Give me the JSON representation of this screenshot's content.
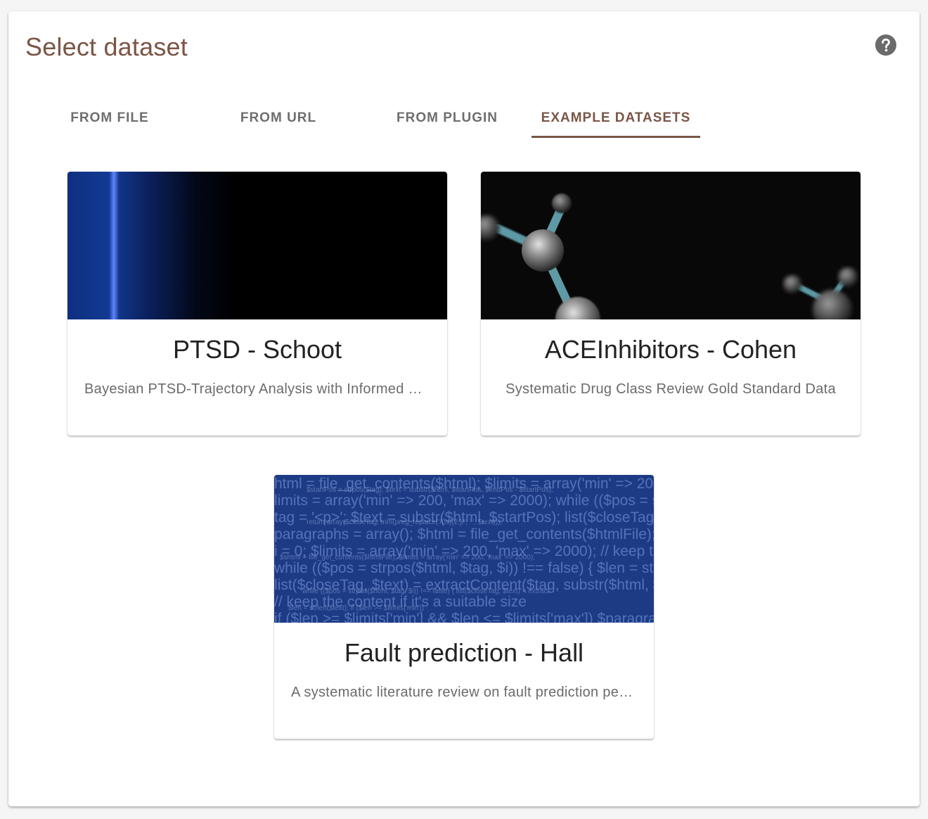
{
  "dialog": {
    "title": "Select dataset",
    "help_icon": "help-circle-icon"
  },
  "tabs": [
    {
      "label": "FROM FILE",
      "active": false
    },
    {
      "label": "FROM URL",
      "active": false
    },
    {
      "label": "FROM PLUGIN",
      "active": false
    },
    {
      "label": "EXAMPLE DATASETS",
      "active": true
    }
  ],
  "colors": {
    "accent": "#7a5546",
    "tab_inactive": "#6e6e6e",
    "code_background": "#1d3b84"
  },
  "datasets": [
    {
      "title": "PTSD - Schoot",
      "description": "Bayesian PTSD-Trajectory Analysis with Informed Priors",
      "image": "blue-light-streak-image"
    },
    {
      "title": "ACEInhibitors - Cohen",
      "description": "Systematic Drug Class Review Gold Standard Data",
      "image": "molecule-image"
    },
    {
      "title": "Fault prediction - Hall",
      "description": "A systematic literature review on fault prediction performance in software engineering",
      "image": "source-code-image"
    }
  ]
}
